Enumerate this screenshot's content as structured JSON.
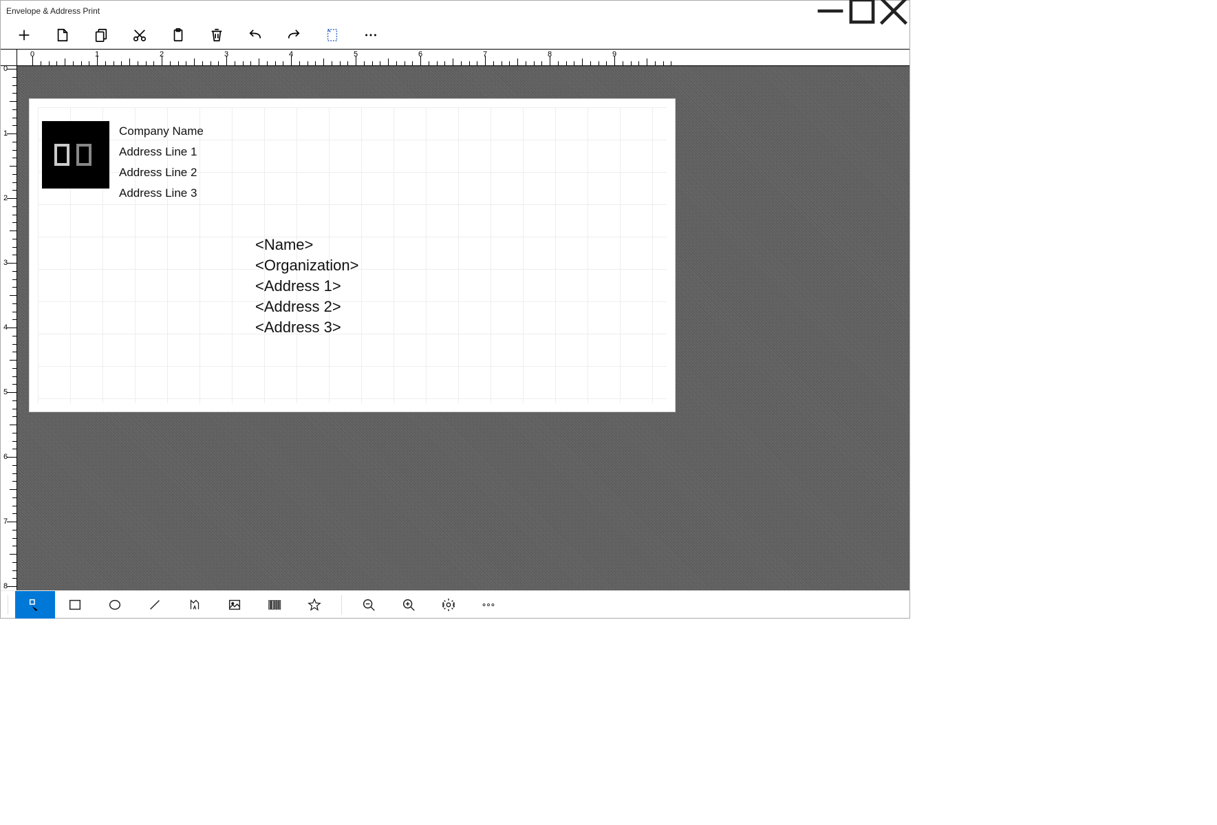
{
  "app": {
    "title": "Envelope & Address Print"
  },
  "toolbar_top": [
    {
      "name": "new",
      "label": "New"
    },
    {
      "name": "save",
      "label": "Save"
    },
    {
      "name": "copy",
      "label": "Copy"
    },
    {
      "name": "cut",
      "label": "Cut"
    },
    {
      "name": "paste",
      "label": "Paste"
    },
    {
      "name": "delete",
      "label": "Delete"
    },
    {
      "name": "undo",
      "label": "Undo"
    },
    {
      "name": "redo",
      "label": "Redo"
    },
    {
      "name": "new-doc",
      "label": "New Document"
    },
    {
      "name": "more",
      "label": "More"
    }
  ],
  "ruler": {
    "numbers": [
      0,
      1,
      2,
      3,
      4,
      5,
      6,
      7,
      8,
      9
    ]
  },
  "envelope": {
    "sender": {
      "company": "Company Name",
      "addr1": "Address Line 1",
      "addr2": "Address Line 2",
      "addr3": "Address Line 3"
    },
    "recipient": {
      "name": "<Name>",
      "organization": "<Organization>",
      "addr1": "<Address 1>",
      "addr2": "<Address 2>",
      "addr3": "<Address 3>"
    }
  },
  "toolbar_bottom": [
    {
      "name": "select",
      "label": "Select",
      "active": true
    },
    {
      "name": "rectangle",
      "label": "Rectangle"
    },
    {
      "name": "ellipse",
      "label": "Ellipse"
    },
    {
      "name": "line",
      "label": "Line"
    },
    {
      "name": "text",
      "label": "Text"
    },
    {
      "name": "image",
      "label": "Image"
    },
    {
      "name": "barcode",
      "label": "Barcode"
    },
    {
      "name": "star",
      "label": "Star"
    },
    {
      "name": "zoom-out",
      "label": "Zoom Out"
    },
    {
      "name": "zoom-in",
      "label": "Zoom In"
    },
    {
      "name": "settings",
      "label": "Settings"
    },
    {
      "name": "more",
      "label": "More"
    }
  ]
}
